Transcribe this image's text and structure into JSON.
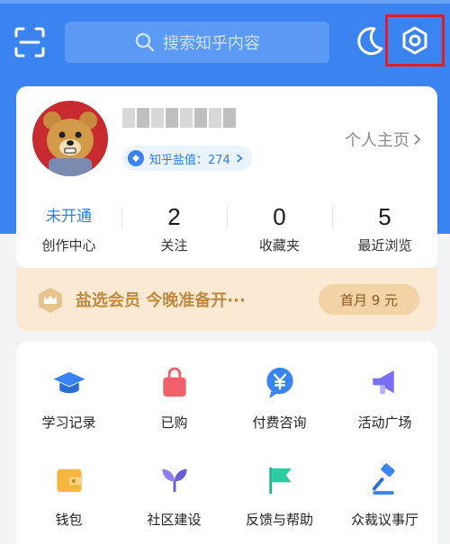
{
  "search": {
    "placeholder": "搜索知乎内容"
  },
  "profile": {
    "salt_label": "知乎盐值：274",
    "homepage_link": "个人主页"
  },
  "stats": [
    {
      "value": "未开通",
      "label": "创作中心"
    },
    {
      "value": "2",
      "label": "关注"
    },
    {
      "value": "0",
      "label": "收藏夹"
    },
    {
      "value": "5",
      "label": "最近浏览"
    }
  ],
  "vip": {
    "text": "盐选会员 今晚准备开···",
    "button": "首月 9 元"
  },
  "grid": [
    {
      "label": "学习记录",
      "icon": "graduation-cap-icon"
    },
    {
      "label": "已购",
      "icon": "shopping-bag-icon"
    },
    {
      "label": "付费咨询",
      "icon": "yen-chat-icon"
    },
    {
      "label": "活动广场",
      "icon": "megaphone-icon"
    },
    {
      "label": "钱包",
      "icon": "wallet-icon"
    },
    {
      "label": "社区建设",
      "icon": "sprout-icon"
    },
    {
      "label": "反馈与帮助",
      "icon": "flag-icon"
    },
    {
      "label": "众裁议事厅",
      "icon": "gavel-icon"
    }
  ],
  "colors": {
    "brand_blue": "#3a84f1",
    "highlight_red": "#e11d2a",
    "vip_gold": "#c08a3e"
  }
}
